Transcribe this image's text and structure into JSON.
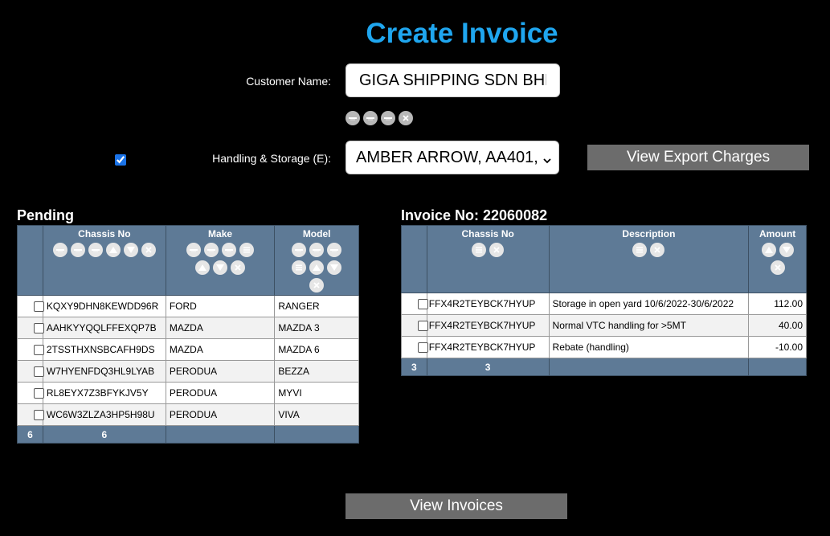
{
  "page": {
    "title": "Create Invoice"
  },
  "customer": {
    "label": "Customer Name:",
    "value": "GIGA SHIPPING SDN BHD,"
  },
  "handling": {
    "label": "Handling & Storage (E):",
    "selected": "AMBER ARROW, AA401, ",
    "checked": true
  },
  "buttons": {
    "view_export_charges": "View Export Charges",
    "view_invoices": "View Invoices"
  },
  "pending": {
    "title": "Pending",
    "columns": [
      "Chassis No",
      "Make",
      "Model"
    ],
    "rows": [
      {
        "chassis": "KQXY9DHN8KEWDD96R",
        "make": "FORD",
        "model": "RANGER"
      },
      {
        "chassis": "AAHKYYQQLFFEXQP7B",
        "make": "MAZDA",
        "model": "MAZDA 3"
      },
      {
        "chassis": "2TSSTHXNSBCAFH9DS",
        "make": "MAZDA",
        "model": "MAZDA 6"
      },
      {
        "chassis": "W7HYENFDQ3HL9LYAB",
        "make": "PERODUA",
        "model": "BEZZA"
      },
      {
        "chassis": "RL8EYX7Z3BFYKJV5Y",
        "make": "PERODUA",
        "model": "MYVI"
      },
      {
        "chassis": "WC6W3ZLZA3HP5H98U",
        "make": "PERODUA",
        "model": "VIVA"
      }
    ],
    "footer": {
      "count": "6",
      "chassis_count": "6"
    }
  },
  "invoice": {
    "title": "Invoice No: 22060082",
    "columns": [
      "Chassis No",
      "Description",
      "Amount"
    ],
    "rows": [
      {
        "chassis": "FFX4R2TEYBCK7HYUP",
        "description": "Storage in open yard 10/6/2022-30/6/2022",
        "amount": "112.00"
      },
      {
        "chassis": "FFX4R2TEYBCK7HYUP",
        "description": "Normal VTC handling for >5MT",
        "amount": "40.00"
      },
      {
        "chassis": "FFX4R2TEYBCK7HYUP",
        "description": "Rebate (handling)",
        "amount": "-10.00"
      }
    ],
    "footer": {
      "count": "3",
      "chassis_count": "3"
    }
  },
  "icons": {
    "customer_ops": [
      "minus-icon",
      "minus-icon",
      "minus-icon",
      "close-icon"
    ],
    "pending_chassis_ops": [
      "minus-icon",
      "minus-icon",
      "minus-icon",
      "triangle-up-icon",
      "triangle-down-icon",
      "close-icon"
    ],
    "pending_make_ops": [
      "minus-icon",
      "minus-icon",
      "minus-icon",
      "list-icon",
      "triangle-up-icon",
      "triangle-down-icon",
      "close-icon"
    ],
    "pending_model_ops": [
      "minus-icon",
      "minus-icon",
      "minus-icon",
      "list-icon",
      "triangle-up-icon",
      "triangle-down-icon",
      "close-icon"
    ],
    "invoice_chassis_ops": [
      "list-icon",
      "close-icon"
    ],
    "invoice_desc_ops": [
      "list-icon",
      "close-icon"
    ],
    "invoice_amount_ops": [
      "triangle-up-icon",
      "triangle-down-icon",
      "close-icon"
    ]
  },
  "colors": {
    "title": "#1fa6ef",
    "header_bg": "#5e7a96",
    "button_bg": "#6c6c6c"
  }
}
